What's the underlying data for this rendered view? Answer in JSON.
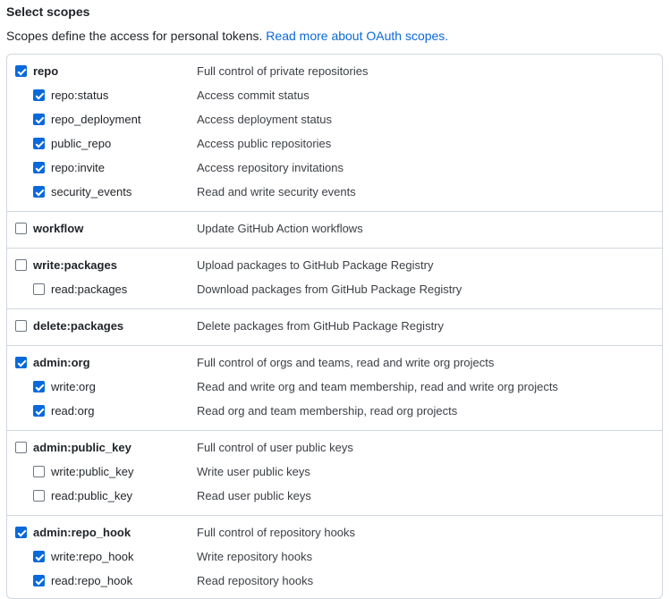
{
  "header": {
    "title": "Select scopes",
    "description": "Scopes define the access for personal tokens.",
    "link_text": "Read more about OAuth scopes."
  },
  "colors": {
    "accent": "#0969da",
    "border": "#d0d7de"
  },
  "groups": [
    {
      "name": "repo",
      "description": "Full control of private repositories",
      "checked": true,
      "children": [
        {
          "name": "repo:status",
          "description": "Access commit status",
          "checked": true
        },
        {
          "name": "repo_deployment",
          "description": "Access deployment status",
          "checked": true
        },
        {
          "name": "public_repo",
          "description": "Access public repositories",
          "checked": true
        },
        {
          "name": "repo:invite",
          "description": "Access repository invitations",
          "checked": true
        },
        {
          "name": "security_events",
          "description": "Read and write security events",
          "checked": true
        }
      ]
    },
    {
      "name": "workflow",
      "description": "Update GitHub Action workflows",
      "checked": false,
      "children": []
    },
    {
      "name": "write:packages",
      "description": "Upload packages to GitHub Package Registry",
      "checked": false,
      "children": [
        {
          "name": "read:packages",
          "description": "Download packages from GitHub Package Registry",
          "checked": false
        }
      ]
    },
    {
      "name": "delete:packages",
      "description": "Delete packages from GitHub Package Registry",
      "checked": false,
      "children": []
    },
    {
      "name": "admin:org",
      "description": "Full control of orgs and teams, read and write org projects",
      "checked": true,
      "children": [
        {
          "name": "write:org",
          "description": "Read and write org and team membership, read and write org projects",
          "checked": true
        },
        {
          "name": "read:org",
          "description": "Read org and team membership, read org projects",
          "checked": true
        }
      ]
    },
    {
      "name": "admin:public_key",
      "description": "Full control of user public keys",
      "checked": false,
      "children": [
        {
          "name": "write:public_key",
          "description": "Write user public keys",
          "checked": false
        },
        {
          "name": "read:public_key",
          "description": "Read user public keys",
          "checked": false
        }
      ]
    },
    {
      "name": "admin:repo_hook",
      "description": "Full control of repository hooks",
      "checked": true,
      "children": [
        {
          "name": "write:repo_hook",
          "description": "Write repository hooks",
          "checked": true
        },
        {
          "name": "read:repo_hook",
          "description": "Read repository hooks",
          "checked": true
        }
      ]
    }
  ]
}
